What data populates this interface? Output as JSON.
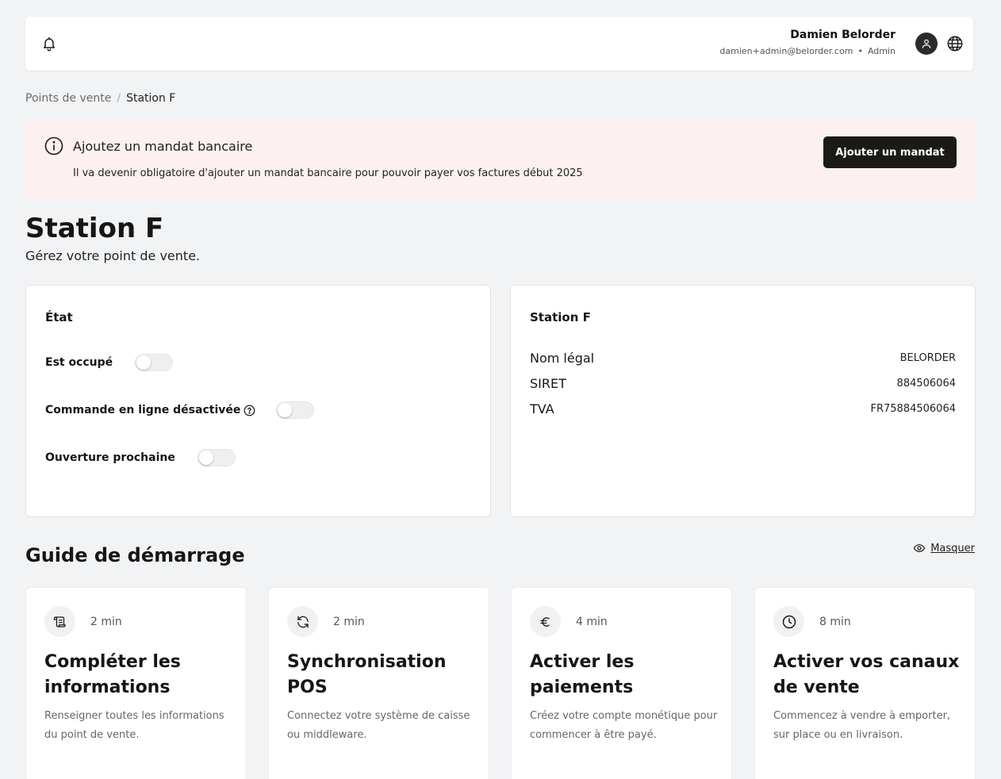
{
  "header": {
    "user_name": "Damien Belorder",
    "user_email": "damien+admin@belorder.com",
    "user_role": "Admin",
    "icons": [
      "bell-icon",
      "user-icon",
      "globe-icon"
    ]
  },
  "breadcrumb": {
    "parent": "Points de vente",
    "separator": "/",
    "current": "Station F"
  },
  "alert": {
    "title": "Ajoutez un mandat bancaire",
    "text": "Il va devenir obligatoire d'ajouter un mandat bancaire pour pouvoir payer vos factures début 2025",
    "button_label": "Ajouter un mandat",
    "background_color": "#fdf0f0"
  },
  "page": {
    "title": "Station F",
    "subtitle": "Gérez votre point de vente."
  },
  "state_card": {
    "title": "État",
    "toggles": [
      {
        "label": "Est occupé",
        "on": false
      },
      {
        "label": "Commande en ligne désactivée",
        "on": false
      },
      {
        "label": "Ouverture prochaine",
        "on": false
      }
    ]
  },
  "info_card": {
    "title": "Station F",
    "rows": [
      {
        "label": "Nom légal",
        "value": "BELORDER"
      },
      {
        "label": "SIRET",
        "value": "884506064"
      },
      {
        "label": "TVA",
        "value": "FR75884506064"
      }
    ]
  },
  "guide": {
    "title": "Guide de démarrage",
    "hide_label": "Masquer",
    "steps": [
      {
        "icon": "scroll-icon",
        "duration": "2 min",
        "title": "Compléter les informations",
        "description": "Renseigner toutes les informations du point de vente."
      },
      {
        "icon": "sync-icon",
        "duration": "2 min",
        "title": "Synchronisation POS",
        "description": "Connectez votre système de caisse ou middleware."
      },
      {
        "icon": "euro-icon",
        "duration": "4 min",
        "title": "Activer les paiements",
        "description": "Créez votre compte monétique pour commencer à être payé."
      },
      {
        "icon": "clock-icon",
        "duration": "8 min",
        "title": "Activer vos canaux de vente",
        "description": "Commencez à vendre à emporter, sur place ou en livraison."
      }
    ]
  },
  "colors": {
    "accent_button": "#1c1a17",
    "page_background": "#f2f3f5"
  }
}
